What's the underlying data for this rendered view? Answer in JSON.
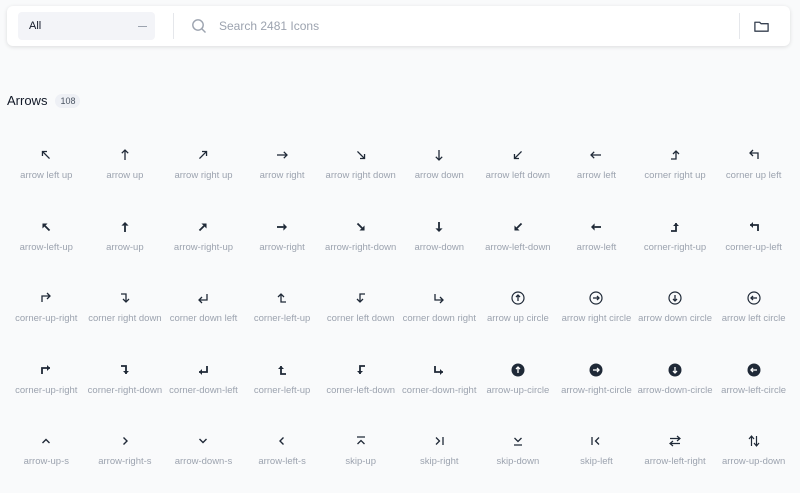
{
  "toolbar": {
    "filter_value": "All",
    "search_placeholder": "Search 2481 Icons",
    "search_value": ""
  },
  "section": {
    "title": "Arrows",
    "count": "108"
  },
  "icons": [
    {
      "label": "arrow left up",
      "icon": "arrow-left-up-icon"
    },
    {
      "label": "arrow up",
      "icon": "arrow-up-icon"
    },
    {
      "label": "arrow right up",
      "icon": "arrow-right-up-icon"
    },
    {
      "label": "arrow right",
      "icon": "arrow-right-icon"
    },
    {
      "label": "arrow right down",
      "icon": "arrow-right-down-icon"
    },
    {
      "label": "arrow down",
      "icon": "arrow-down-icon"
    },
    {
      "label": "arrow left down",
      "icon": "arrow-left-down-icon"
    },
    {
      "label": "arrow left",
      "icon": "arrow-left-icon"
    },
    {
      "label": "corner right up",
      "icon": "corner-right-up-icon"
    },
    {
      "label": "corner up left",
      "icon": "corner-up-left-icon"
    },
    {
      "label": "arrow-left-up",
      "icon": "arrow-left-up-bold-icon"
    },
    {
      "label": "arrow-up",
      "icon": "arrow-up-bold-icon"
    },
    {
      "label": "arrow-right-up",
      "icon": "arrow-right-up-bold-icon"
    },
    {
      "label": "arrow-right",
      "icon": "arrow-right-bold-icon"
    },
    {
      "label": "arrow-right-down",
      "icon": "arrow-right-down-bold-icon"
    },
    {
      "label": "arrow-down",
      "icon": "arrow-down-bold-icon"
    },
    {
      "label": "arrow-left-down",
      "icon": "arrow-left-down-bold-icon"
    },
    {
      "label": "arrow-left",
      "icon": "arrow-left-bold-icon"
    },
    {
      "label": "corner-right-up",
      "icon": "corner-right-up-bold-icon"
    },
    {
      "label": "corner-up-left",
      "icon": "corner-up-left-bold-icon"
    },
    {
      "label": "corner-up-right",
      "icon": "corner-up-right-icon"
    },
    {
      "label": "corner right down",
      "icon": "corner-right-down-icon"
    },
    {
      "label": "corner down left",
      "icon": "corner-down-left-icon"
    },
    {
      "label": "corner-left-up",
      "icon": "corner-left-up-icon"
    },
    {
      "label": "corner left down",
      "icon": "corner-left-down-icon"
    },
    {
      "label": "corner down right",
      "icon": "corner-down-right-icon"
    },
    {
      "label": "arrow up circle",
      "icon": "arrow-up-circle-icon"
    },
    {
      "label": "arrow right circle",
      "icon": "arrow-right-circle-icon"
    },
    {
      "label": "arrow down circle",
      "icon": "arrow-down-circle-icon"
    },
    {
      "label": "arrow left circle",
      "icon": "arrow-left-circle-icon"
    },
    {
      "label": "corner-up-right",
      "icon": "corner-up-right-bold-icon"
    },
    {
      "label": "corner-right-down",
      "icon": "corner-right-down-bold-icon"
    },
    {
      "label": "corner-down-left",
      "icon": "corner-down-left-bold-icon"
    },
    {
      "label": "corner-left-up",
      "icon": "corner-left-up-bold-icon"
    },
    {
      "label": "corner-left-down",
      "icon": "corner-left-down-bold-icon"
    },
    {
      "label": "corner-down-right",
      "icon": "corner-down-right-bold-icon"
    },
    {
      "label": "arrow-up-circle",
      "icon": "arrow-up-circle-filled-icon"
    },
    {
      "label": "arrow-right-circle",
      "icon": "arrow-right-circle-filled-icon"
    },
    {
      "label": "arrow-down-circle",
      "icon": "arrow-down-circle-filled-icon"
    },
    {
      "label": "arrow-left-circle",
      "icon": "arrow-left-circle-filled-icon"
    },
    {
      "label": "arrow-up-s",
      "icon": "chevron-up-icon"
    },
    {
      "label": "arrow-right-s",
      "icon": "chevron-right-icon"
    },
    {
      "label": "arrow-down-s",
      "icon": "chevron-down-icon"
    },
    {
      "label": "arrow-left-s",
      "icon": "chevron-left-icon"
    },
    {
      "label": "skip-up",
      "icon": "skip-up-icon"
    },
    {
      "label": "skip-right",
      "icon": "skip-right-icon"
    },
    {
      "label": "skip-down",
      "icon": "skip-down-icon"
    },
    {
      "label": "skip-left",
      "icon": "skip-left-icon"
    },
    {
      "label": "arrow-left-right",
      "icon": "arrow-left-right-icon"
    },
    {
      "label": "arrow-up-down",
      "icon": "arrow-up-down-icon"
    }
  ],
  "colors": {
    "icon": "#1f2937",
    "label": "#9ca3af",
    "background": "#f9fafb"
  }
}
